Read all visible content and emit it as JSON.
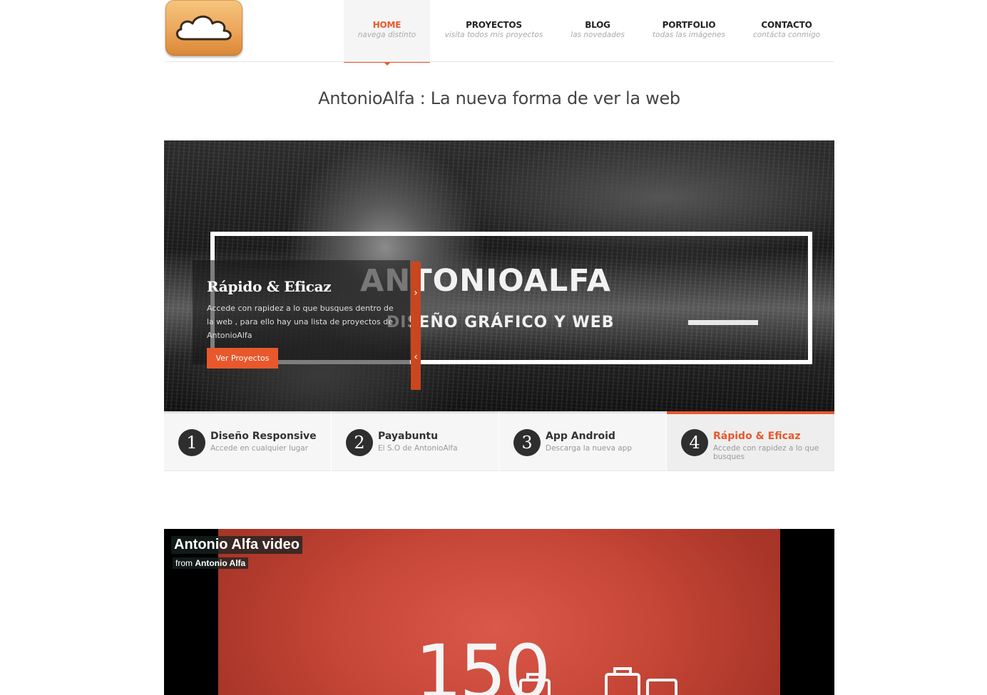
{
  "header": {
    "logo": "cloud-logo",
    "nav": [
      {
        "label": "HOME",
        "sub": "navega distinto",
        "active": true
      },
      {
        "label": "PROYECTOS",
        "sub": "visita todos mis proyectos",
        "active": false
      },
      {
        "label": "BLOG",
        "sub": "las novedades",
        "active": false
      },
      {
        "label": "PORTFOLIO",
        "sub": "todas las imágenes",
        "active": false
      },
      {
        "label": "CONTACTO",
        "sub": "contácta conmigo",
        "active": false
      }
    ]
  },
  "tagline": "AntonioAlfa : La nueva forma de ver la web",
  "slider": {
    "brand_title": "ANTONIOALFA",
    "brand_subtitle": "DISEÑO GRÁFICO Y WEB",
    "caption_title": "Rápido & Eficaz",
    "caption_text": "Accede con rapidez a lo que busques dentro de la web , para ello hay una lista de proyectos de AntonioAlfa",
    "cta_label": "Ver Proyectos",
    "tabs": [
      {
        "num": "1",
        "title": "Diseño Responsive",
        "sub": "Accede en cualquier lugar",
        "active": false
      },
      {
        "num": "2",
        "title": "Payabuntu",
        "sub": "El S.O de AntonioAlfa",
        "active": false
      },
      {
        "num": "3",
        "title": "App Android",
        "sub": "Descarga la nueva app",
        "active": false
      },
      {
        "num": "4",
        "title": "Rápido & Eficaz",
        "sub": "Accede con rapidez a lo que busques",
        "active": true
      }
    ]
  },
  "video": {
    "title": "Antonio Alfa video",
    "byline_prefix": "from",
    "byline_author": "Antonio Alfa",
    "frame_text": "150"
  },
  "colors": {
    "accent": "#e8582c",
    "dark": "#2e2e2e"
  }
}
